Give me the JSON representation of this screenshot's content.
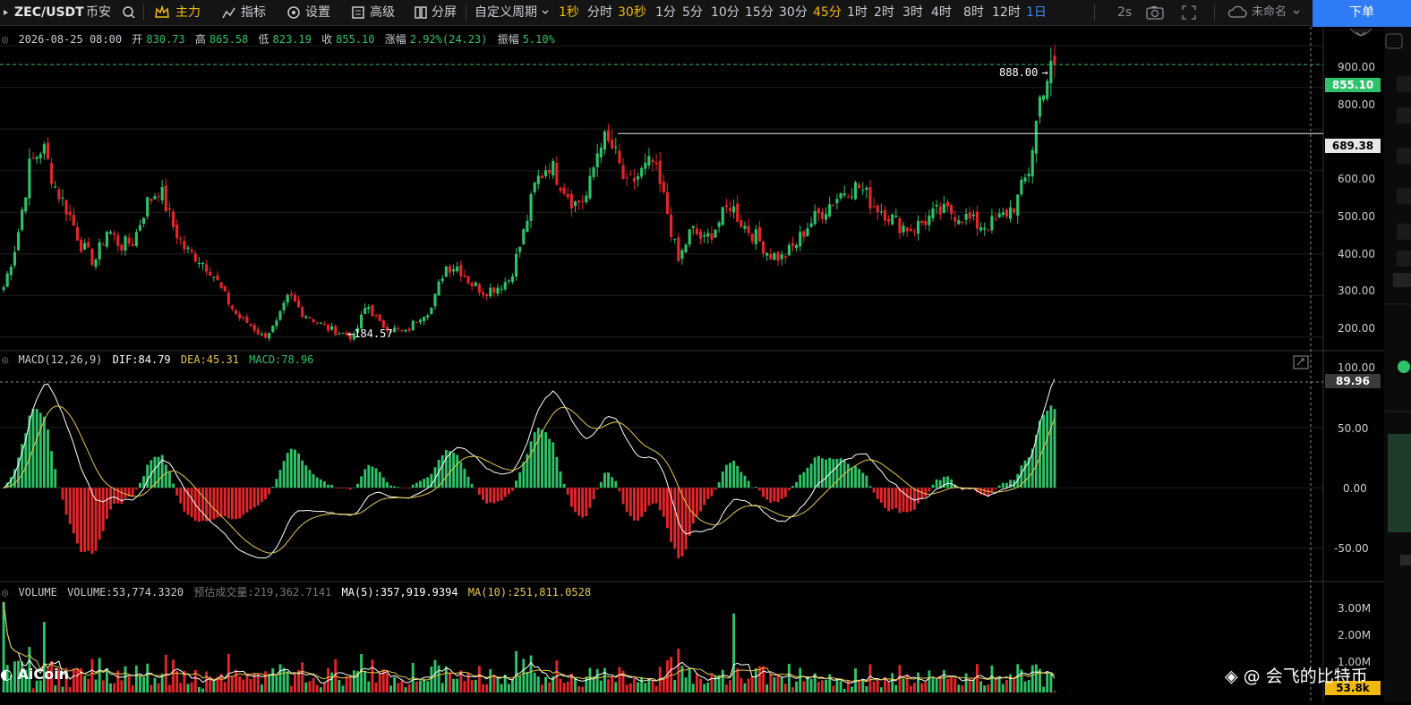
{
  "toolbar": {
    "symbol": "ZEC/USDT",
    "exchange": "币安",
    "main_label": "主力",
    "indicator_label": "指标",
    "settings_label": "设置",
    "advanced_label": "高级",
    "split_label": "分屏",
    "custom_period_label": "自定义周期",
    "periods": [
      "1秒",
      "分时",
      "30秒",
      "1分",
      "5分",
      "10分",
      "15分",
      "30分",
      "45分",
      "1时",
      "2时",
      "3时",
      "4时",
      "8时",
      "12时",
      "1日"
    ],
    "highlighted_periods": [
      "1秒",
      "30秒",
      "45分"
    ],
    "active_period": "1日",
    "refresh": "2s",
    "layout_name": "未命名",
    "order_button": "下单"
  },
  "ohlc": {
    "date": "2026-08-25 08:00",
    "open_label": "开",
    "open": "830.73",
    "high_label": "高",
    "high": "865.58",
    "low_label": "低",
    "low": "823.19",
    "close_label": "收",
    "close": "855.10",
    "change_label": "涨幅",
    "change": "2.92%(24.23)",
    "amplitude_label": "振幅",
    "amplitude": "5.10%"
  },
  "macd": {
    "name": "MACD(12,26,9)",
    "dif": "DIF:84.79",
    "dea": "DEA:45.31",
    "macd": "MACD:78.96"
  },
  "volume": {
    "name": "VOLUME",
    "value": "VOLUME:53,774.3320",
    "estimated": "预估成交量:219,362.7141",
    "ma5": "MA(5):357,919.9394",
    "ma10": "MA(10):251,811.0528"
  },
  "price_axis": [
    "900.00",
    "800.00",
    "600.00",
    "500.00",
    "400.00",
    "300.00",
    "200.00"
  ],
  "macd_axis": [
    "100.00",
    "50.00",
    "0.00",
    "-50.00"
  ],
  "volume_axis": [
    "3.00M",
    "2.00M",
    "1.00M"
  ],
  "markers": {
    "high_marker": "888.00",
    "low_marker": "184.57",
    "current_price": "855.10",
    "line_price": "689.38",
    "macd_cursor": "89.96",
    "volume_current": "53.8k"
  },
  "watermark": {
    "brand": "AiCoin",
    "author": "@ 会飞的比特币"
  },
  "colors": {
    "up": "#2ec36a",
    "down": "#e5252a",
    "dif": "#ffffff",
    "dea": "#e6c84a",
    "accent": "#f0b90b",
    "button": "#2f7cf6"
  },
  "chart_data": {
    "type": "candlestick",
    "interval": "1日",
    "close_price_path": [
      320,
      430,
      610,
      660,
      560,
      500,
      420,
      380,
      460,
      420,
      430,
      520,
      560,
      470,
      410,
      390,
      360,
      300,
      250,
      230,
      200,
      230,
      300,
      260,
      240,
      220,
      210,
      200,
      280,
      230,
      220,
      210,
      250,
      270,
      370,
      370,
      330,
      310,
      320,
      340,
      440,
      570,
      620,
      570,
      520,
      540,
      680,
      650,
      560,
      590,
      620,
      520,
      380,
      460,
      430,
      470,
      520,
      470,
      440,
      400,
      390,
      420,
      470,
      500,
      530,
      560,
      560,
      520,
      500,
      470,
      460,
      480,
      500,
      500,
      490,
      470,
      470,
      490,
      520,
      600,
      800,
      855
    ],
    "price_ylim": [
      150,
      920
    ],
    "price_high": 888.0,
    "price_low": 184.57,
    "macd_ylim": [
      -75,
      105
    ],
    "volume_ylim": [
      0,
      3300000
    ]
  }
}
